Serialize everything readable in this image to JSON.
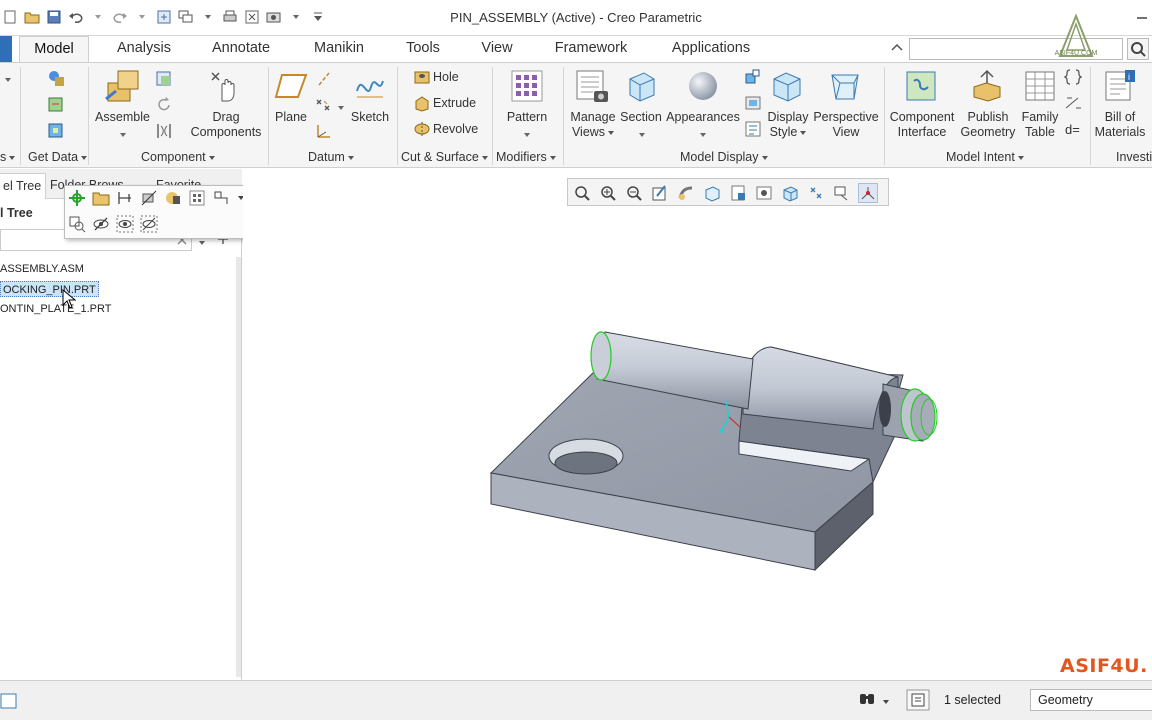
{
  "window": {
    "title": "PIN_ASSEMBLY (Active) - Creo Parametric"
  },
  "tabs": [
    "Model",
    "Analysis",
    "Annotate",
    "Manikin",
    "Tools",
    "View",
    "Framework",
    "Applications"
  ],
  "active_tab": "Model",
  "ribbon": {
    "get_data": {
      "label": "Get Data"
    },
    "component": {
      "label": "Component",
      "assemble": "Assemble",
      "drag": [
        "Drag",
        "Components"
      ]
    },
    "datum": {
      "label": "Datum",
      "plane": "Plane",
      "sketch": "Sketch"
    },
    "cut_surface": {
      "label": "Cut & Surface",
      "hole": "Hole",
      "extrude": "Extrude",
      "revolve": "Revolve"
    },
    "modifiers": {
      "label": "Modifiers",
      "pattern": "Pattern"
    },
    "model_display": {
      "label": "Model Display",
      "manage_views": [
        "Manage",
        "Views"
      ],
      "section": "Section",
      "appearances": "Appearances",
      "display_style": [
        "Display",
        "Style"
      ],
      "perspective_view": [
        "Perspective",
        "View"
      ]
    },
    "model_intent": {
      "label": "Model Intent",
      "component_interface": [
        "Component",
        "Interface"
      ],
      "publish_geometry": [
        "Publish",
        "Geometry"
      ],
      "family_table": [
        "Family",
        "Table"
      ]
    },
    "investigate": {
      "label": "Investi",
      "bill_of_materials": [
        "Bill of",
        "Materials"
      ]
    },
    "left_group_label": "s"
  },
  "navigator": {
    "tabs": [
      "el Tree",
      "Folder Brows",
      "Favorite"
    ],
    "tree_header": "l Tree",
    "items": [
      "ASSEMBLY.ASM",
      "OCKING_PIN.PRT",
      "ONTIN_PLATE_1.PRT"
    ]
  },
  "logo_text": "ASIF4U.COM",
  "watermark": "ASIF4U.",
  "status": {
    "selected": "1 selected",
    "filter": "Geometry"
  },
  "colors": {
    "accent": "#2f6fb6",
    "watermark": "#e2571e",
    "part": "#b9bfca",
    "edge_highlight": "#22cc22"
  }
}
